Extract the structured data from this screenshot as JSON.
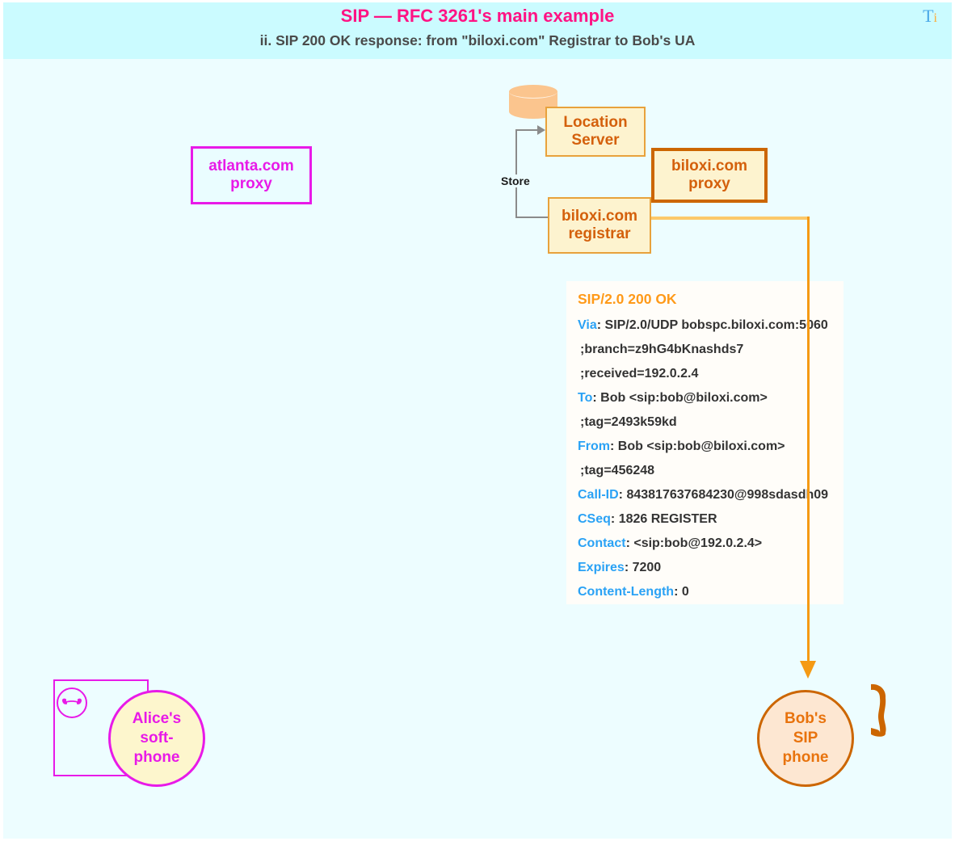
{
  "header": {
    "title": "SIP — RFC 3261's main example",
    "subtitle": "ii.  SIP 200 OK response: from \"biloxi.com\" Registrar to Bob's UA",
    "logo_t": "T",
    "logo_i": "i",
    "title_color": "#ff1384",
    "band_color": "#cbfbff"
  },
  "canvas": {
    "background": "#edfdff"
  },
  "nodes": {
    "atlanta_proxy": {
      "line1": "atlanta.com",
      "line2": "proxy",
      "color": "#e81ae8",
      "fill": "#eafdff"
    },
    "location_server": {
      "line1": "Location",
      "line2": "Server",
      "color": "#d4600c",
      "fill": "#fdf3cf"
    },
    "biloxi_proxy": {
      "line1": "biloxi.com",
      "line2": "proxy",
      "color": "#d4600c",
      "fill": "#fdf3cf"
    },
    "biloxi_registrar": {
      "line1": "biloxi.com",
      "line2": "registrar",
      "color": "#d4600c",
      "fill": "#fdf3cf"
    },
    "alice_phone": {
      "line1": "Alice's",
      "line2": "soft-",
      "line3": "phone",
      "color": "#e81ae8",
      "fill": "#fdf6cd"
    },
    "bob_phone": {
      "line1": "Bob's",
      "line2": "SIP",
      "line3": "phone",
      "color": "#e8730d",
      "fill": "#fde7d2"
    }
  },
  "arrows": {
    "store_label": "Store",
    "store_color": "#8b8b8b",
    "flow_color": "#f59a14"
  },
  "sip_message": {
    "start_line": "SIP/2.0 200 OK",
    "start_color": "#ff9a19",
    "header_color": "#2aa2f5",
    "lines": [
      {
        "header": "Via",
        "sep": ": ",
        "value": "SIP/2.0/UDP bobspc.biloxi.com:5060",
        "continuation": false
      },
      {
        "header": "",
        "sep": "",
        "value": ";branch=z9hG4bKnashds7",
        "continuation": true
      },
      {
        "header": "",
        "sep": "",
        "value": ";received=192.0.2.4",
        "continuation": true
      },
      {
        "header": "To",
        "sep": ": ",
        "value": "Bob <sip:bob@biloxi.com>",
        "continuation": false
      },
      {
        "header": "",
        "sep": "",
        "value": ";tag=2493k59kd",
        "continuation": true
      },
      {
        "header": "From",
        "sep": ": ",
        "value": "Bob <sip:bob@biloxi.com>",
        "continuation": false
      },
      {
        "header": "",
        "sep": "",
        "value": ";tag=456248",
        "continuation": true
      },
      {
        "header": "Call-ID",
        "sep": ": ",
        "value": "843817637684230@998sdasdh09",
        "continuation": false
      },
      {
        "header": "CSeq",
        "sep": ": ",
        "value": "1826 REGISTER",
        "continuation": false
      },
      {
        "header": "Contact",
        "sep": ": ",
        "value": "<sip:bob@192.0.2.4>",
        "continuation": false
      },
      {
        "header": "Expires",
        "sep": ": ",
        "value": "7200",
        "continuation": false
      },
      {
        "header": "Content-Length",
        "sep": ": ",
        "value": "0",
        "continuation": false
      }
    ]
  },
  "icons": {
    "database": "database-cylinder-icon",
    "alice_handset": "phone-handset-icon",
    "bob_handset": "phone-handset-icon"
  }
}
